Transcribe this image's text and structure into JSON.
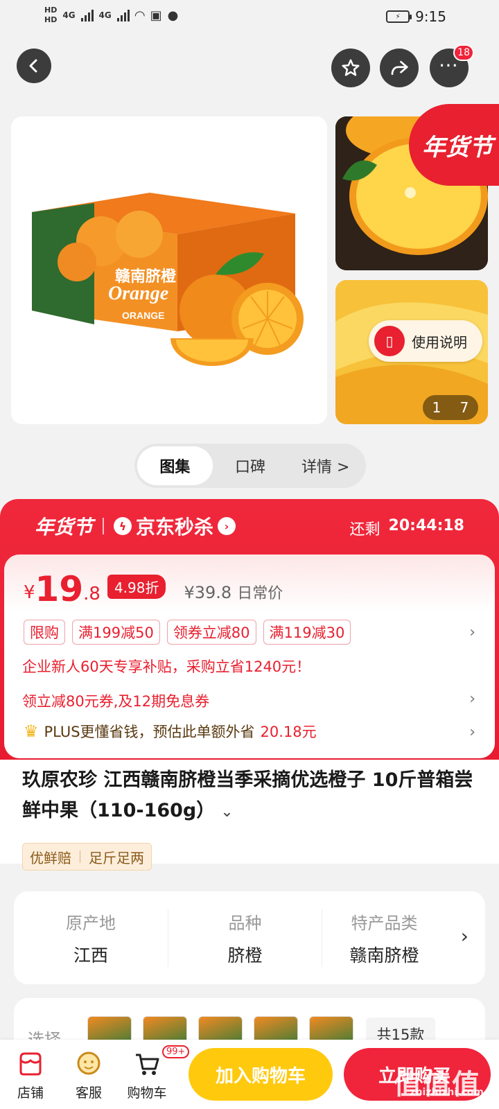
{
  "status_bar": {
    "time": "9:15",
    "hd1": "HD",
    "hd2": "HD",
    "net1": "4G",
    "net2": "4G"
  },
  "top_nav": {
    "more_badge": "18"
  },
  "gallery": {
    "box_brand": "赣南脐橙",
    "box_english": "Orange",
    "box_label": "ORANGE",
    "side_tag": "年货节",
    "guide_label": "使用说明",
    "counter_current": "1",
    "counter_total": "7"
  },
  "tabs": [
    {
      "label": "图集",
      "active": true
    },
    {
      "label": "口碑",
      "active": false
    },
    {
      "label": "详情 >",
      "active": false
    }
  ],
  "promo": {
    "festival": "年货节",
    "jd_seckill": "京东秒杀",
    "remain_label": "还剩",
    "remain_time": "20:44:18",
    "currency": "¥",
    "price_int": "19",
    "price_dec": ".8",
    "discount": "4.98折",
    "orig_price": "¥39.8",
    "orig_label": "日常价",
    "coupons": [
      "限购",
      "满199减50",
      "领券立减80",
      "满119减30"
    ],
    "line1": "企业新人60天专享补贴，采购立省1240元！",
    "line2": "领立减80元券,及12期免息券",
    "plus_text": "PLUS更懂省钱，预估此单额外省",
    "plus_amount": "20.18元"
  },
  "product": {
    "title": "玖原农珍 江西赣南脐橙当季采摘优选橙子 10斤普箱尝鲜中果（110-160g）",
    "tag1": "优鲜赔",
    "tag2": "足斤足两"
  },
  "attributes": [
    {
      "key": "原产地",
      "value": "江西"
    },
    {
      "key": "品种",
      "value": "脐橙"
    },
    {
      "key": "特产品类",
      "value": "赣南脐橙"
    }
  ],
  "choose": {
    "label": "选择",
    "count": "共15款"
  },
  "bottom_bar": {
    "shop": "店铺",
    "service": "客服",
    "cart": "购物车",
    "cart_badge": "99+",
    "add_to_cart": "加入购物车",
    "buy_now": "立即购买",
    "watermark": "值值值",
    "watermark_url": "zhizhizhi.com"
  },
  "colors": {
    "accent": "#e8202f",
    "cart_button": "#ffc90e",
    "buy_button": "#f0243b"
  }
}
